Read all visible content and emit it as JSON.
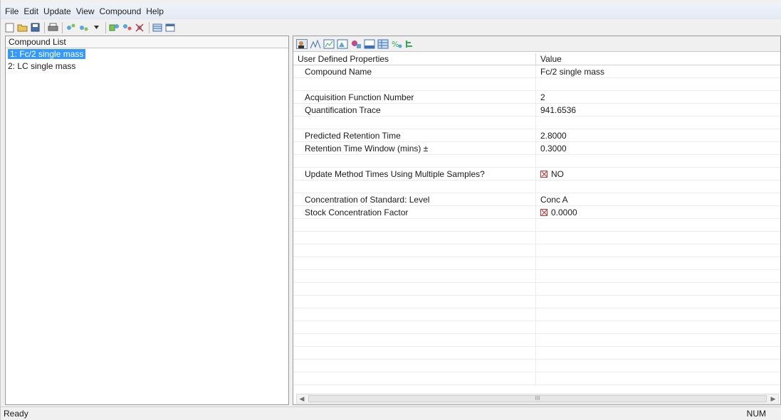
{
  "menu": [
    "File",
    "Edit",
    "Update",
    "View",
    "Compound",
    "Help"
  ],
  "toolbar_icons": [
    "new-icon",
    "open-icon",
    "save-icon",
    "print-icon",
    "compound-add-icon",
    "compound-insert-icon",
    "dropdown-arrow-icon",
    "copy-icon",
    "compound-up-icon",
    "compound-delete-icon",
    "grid-view-icon",
    "window-icon"
  ],
  "compound_list": {
    "header": "Compound List",
    "items": [
      "1: Fc/2 single mass",
      "2: LC single mass"
    ],
    "selected_index": 0
  },
  "properties_toolbar_icons": [
    "user-properties-icon",
    "peak-icon",
    "chart-icon",
    "integration-icon",
    "calibration-icon",
    "window-icon",
    "table-icon",
    "percent-icon",
    "tree-icon"
  ],
  "properties": {
    "col_property": "User Defined Properties",
    "col_value": "Value",
    "rows": [
      {
        "label": "Compound Name",
        "value": "Fc/2 single mass",
        "checkbox": false
      },
      {
        "label": "",
        "value": "",
        "checkbox": false
      },
      {
        "label": "Acquisition Function Number",
        "value": "2",
        "checkbox": false
      },
      {
        "label": "Quantification Trace",
        "value": "941.6536",
        "checkbox": false
      },
      {
        "label": "",
        "value": "",
        "checkbox": false
      },
      {
        "label": "Predicted Retention Time",
        "value": "2.8000",
        "checkbox": false
      },
      {
        "label": "Retention Time Window (mins) ±",
        "value": "0.3000",
        "checkbox": false
      },
      {
        "label": "",
        "value": "",
        "checkbox": false
      },
      {
        "label": "Update Method Times Using Multiple Samples?",
        "value": "NO",
        "checkbox": true
      },
      {
        "label": "",
        "value": "",
        "checkbox": false
      },
      {
        "label": "Concentration of Standard: Level",
        "value": "Conc A",
        "checkbox": false
      },
      {
        "label": "Stock Concentration Factor",
        "value": "0.0000",
        "checkbox": true
      },
      {
        "label": "",
        "value": "",
        "checkbox": false
      },
      {
        "label": "",
        "value": "",
        "checkbox": false
      },
      {
        "label": "",
        "value": "",
        "checkbox": false
      },
      {
        "label": "",
        "value": "",
        "checkbox": false
      },
      {
        "label": "",
        "value": "",
        "checkbox": false
      },
      {
        "label": "",
        "value": "",
        "checkbox": false
      },
      {
        "label": "",
        "value": "",
        "checkbox": false
      },
      {
        "label": "",
        "value": "",
        "checkbox": false
      },
      {
        "label": "",
        "value": "",
        "checkbox": false
      },
      {
        "label": "",
        "value": "",
        "checkbox": false
      },
      {
        "label": "",
        "value": "",
        "checkbox": false
      },
      {
        "label": "",
        "value": "",
        "checkbox": false
      },
      {
        "label": "",
        "value": "",
        "checkbox": false
      },
      {
        "label": "",
        "value": "",
        "checkbox": false
      }
    ]
  },
  "scroll_thumb": "III",
  "status": {
    "left": "Ready",
    "right": "NUM"
  },
  "colors": {
    "selection": "#3399ff",
    "checkbox_red": "#d03030"
  }
}
